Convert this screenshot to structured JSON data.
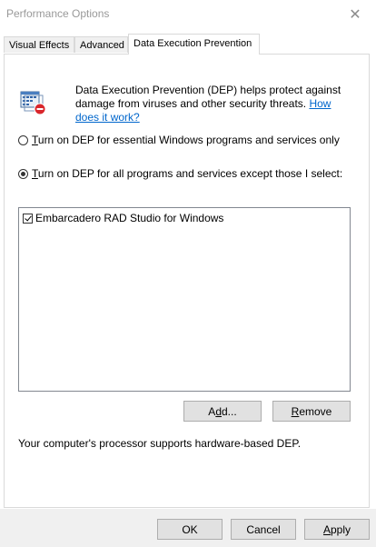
{
  "window": {
    "title": "Performance Options",
    "close_glyph": "✕"
  },
  "tabs": [
    {
      "label": "Visual Effects"
    },
    {
      "label": "Advanced"
    },
    {
      "label": "Data Execution Prevention"
    }
  ],
  "intro": {
    "text": "Data Execution Prevention (DEP) helps protect against damage from viruses and other security threats. ",
    "link": "How does it work?",
    "icon": "dep-shield-icon"
  },
  "options": {
    "essential": {
      "accel": "T",
      "rest": "urn on DEP for essential Windows programs and services only",
      "selected": false
    },
    "all": {
      "accel": "T",
      "rest": "urn on DEP for all programs and services except those I select:",
      "selected": true
    }
  },
  "exceptions_list": [
    {
      "label": "Embarcadero RAD Studio for Windows",
      "checked": true
    }
  ],
  "buttons": {
    "add": {
      "pre": "A",
      "accel": "d",
      "post": "d..."
    },
    "remove": {
      "pre": "",
      "accel": "R",
      "post": "emove"
    },
    "ok": "OK",
    "cancel": "Cancel",
    "apply": {
      "pre": "",
      "accel": "A",
      "post": "pply"
    }
  },
  "support_text": "Your computer's processor supports hardware-based DEP."
}
